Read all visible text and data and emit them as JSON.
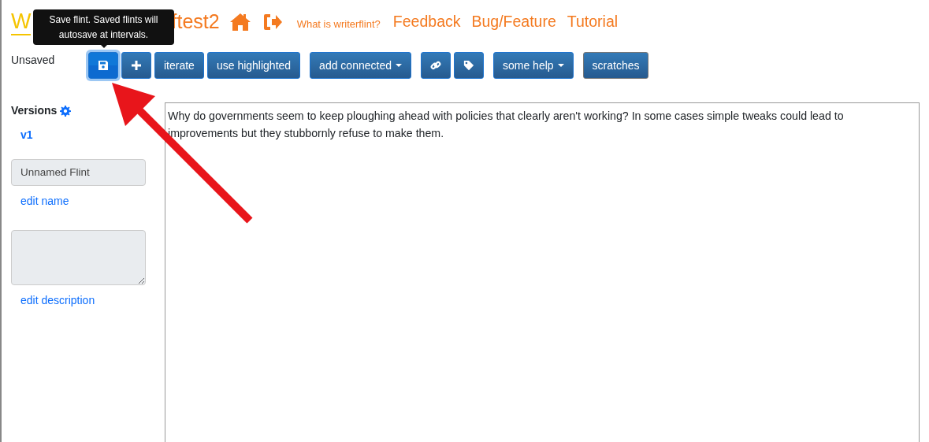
{
  "header": {
    "logo": "W",
    "title": "ftest2",
    "about_link": "What is writerflint?",
    "links": [
      "Feedback",
      "Bug/Feature",
      "Tutorial"
    ]
  },
  "save_status": "Unsaved",
  "toolbar": [
    [
      {
        "kind": "icon",
        "selected": true
      },
      {
        "kind": "icon",
        "selected": false
      },
      {
        "kind": "text",
        "label": "iterate",
        "selected": false
      },
      {
        "kind": "text",
        "label": "use highlighted",
        "selected": false
      }
    ],
    [
      {
        "kind": "dropdown",
        "label": "add connected",
        "selected": false
      }
    ],
    [
      {
        "kind": "icon",
        "selected": false
      },
      {
        "kind": "icon",
        "selected": false
      }
    ],
    [
      {
        "kind": "dropdown",
        "label": "some help",
        "selected": false
      }
    ],
    [
      {
        "kind": "text",
        "label": "scratches",
        "selected": false
      }
    ]
  ],
  "tooltip": "Save flint. Saved flints will autosave at intervals.",
  "sidebar": {
    "heading": "Versions",
    "versions": [
      "v1"
    ],
    "name_value": "Unnamed Flint",
    "edit_name": "edit name",
    "edit_description": "edit description"
  },
  "editor": {
    "text": "Why do governments seem to keep ploughing ahead with policies that clearly aren't working? In some cases simple tweaks could lead to improvements but they stubbornly refuse to make them."
  }
}
